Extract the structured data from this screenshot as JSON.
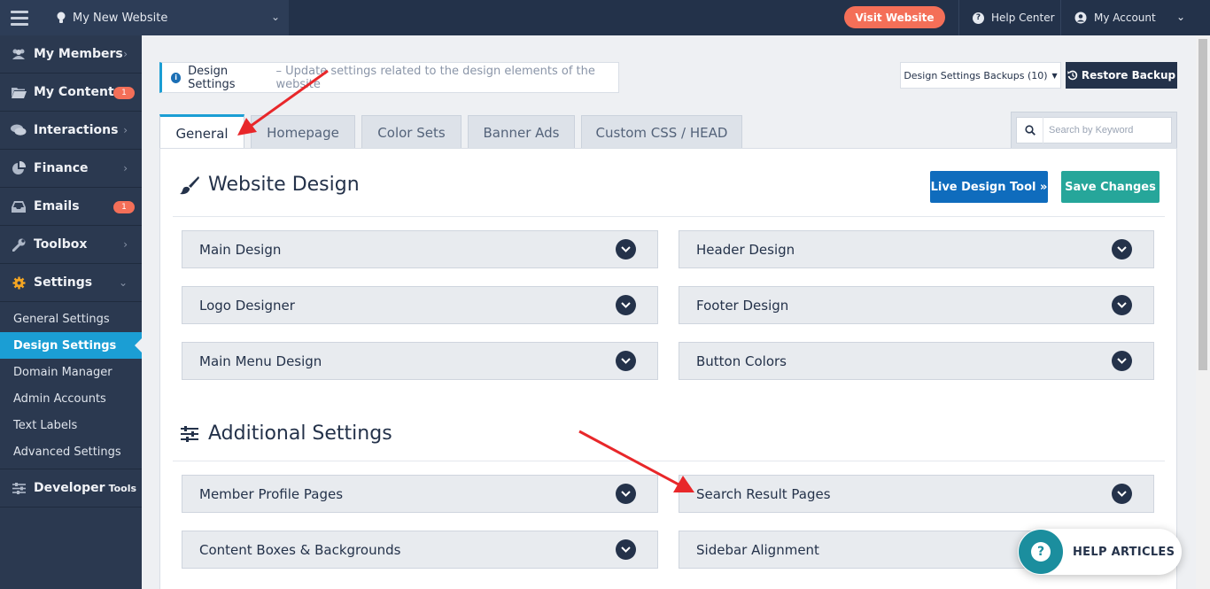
{
  "topbar": {
    "site_name": "My New Website",
    "visit_label": "Visit Website",
    "help_center_label": "Help Center",
    "my_account_label": "My Account"
  },
  "sidebar": {
    "items": [
      {
        "label": "My Members",
        "icon": "users-icon"
      },
      {
        "label": "My Content",
        "icon": "folder-icon",
        "badge": "1"
      },
      {
        "label": "Interactions",
        "icon": "comments-icon"
      },
      {
        "label": "Finance",
        "icon": "pie-chart-icon"
      },
      {
        "label": "Emails",
        "icon": "inbox-icon",
        "badge": "1"
      },
      {
        "label": "Toolbox",
        "icon": "wrench-icon"
      },
      {
        "label": "Settings",
        "icon": "gear-icon"
      }
    ],
    "settings_sub": [
      "General Settings",
      "Design Settings",
      "Domain Manager",
      "Admin Accounts",
      "Text Labels",
      "Advanced Settings"
    ],
    "developer_label": "Developer",
    "developer_small": "Tools"
  },
  "header": {
    "title": "Design Settings",
    "description": "– Update settings related to the design elements of the website",
    "backups_label": "Design Settings Backups (10)",
    "restore_label": "Restore Backup"
  },
  "tabs": [
    "General",
    "Homepage",
    "Color Sets",
    "Banner Ads",
    "Custom CSS / HEAD"
  ],
  "search": {
    "placeholder": "Search by Keyword"
  },
  "website_design": {
    "title": "Website Design",
    "live_tool_label": "Live Design Tool »",
    "save_label": "Save Changes",
    "items": [
      "Main Design",
      "Header Design",
      "Logo Designer",
      "Footer Design",
      "Main Menu Design",
      "Button Colors"
    ]
  },
  "additional": {
    "title": "Additional Settings",
    "items": [
      "Member Profile Pages",
      "Search Result Pages",
      "Content Boxes & Backgrounds",
      "Sidebar Alignment"
    ]
  },
  "help_articles_label": "HELP ARTICLES",
  "colors": {
    "navy": "#23324a",
    "accent_blue": "#1b9ed4",
    "coral": "#f46f58",
    "teal": "#26a69a",
    "arrow_red": "#e8272a"
  }
}
